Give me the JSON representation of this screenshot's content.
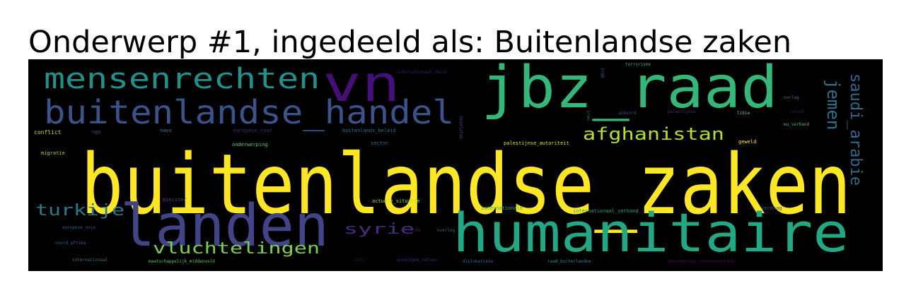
{
  "title": "Onderwerp #1, ingedeeld als: Buitenlandse zaken",
  "wordcloud": {
    "background": "#000000",
    "colormap": "viridis",
    "words": [
      {
        "text": "buitenlandse_zaken",
        "color": "#fde725"
      },
      {
        "text": "humanitaire",
        "color": "#22a884"
      },
      {
        "text": "landen",
        "color": "#414487"
      },
      {
        "text": "jbz_raad",
        "color": "#35b779"
      },
      {
        "text": "vn",
        "color": "#440f76"
      },
      {
        "text": "buitenlandse_handel",
        "color": "#3b528b"
      },
      {
        "text": "mensenrechten",
        "color": "#21918c"
      },
      {
        "text": "afghanistan",
        "color": "#b5de2b"
      },
      {
        "text": "vluchtelingen",
        "color": "#7ad151"
      },
      {
        "text": "turkije",
        "color": "#2a788e"
      },
      {
        "text": "syrie",
        "color": "#472d7b"
      },
      {
        "text": "jemen",
        "color": "#2c728e"
      },
      {
        "text": "saudi_arabie",
        "color": "#31688e"
      },
      {
        "text": "conflict",
        "color": "#bddf26"
      },
      {
        "text": "ngo",
        "color": "#3e4a89"
      },
      {
        "text": "navo",
        "color": "#26828e"
      },
      {
        "text": "europese_raad",
        "color": "#482173"
      },
      {
        "text": "buitenlands_beleid",
        "color": "#2e6e8e"
      },
      {
        "text": "internationaal_recht",
        "color": "#481a6c"
      },
      {
        "text": "terrorisme",
        "color": "#1fa187"
      },
      {
        "text": "israel",
        "color": "#471164"
      },
      {
        "text": "eu_verband",
        "color": "#3dbc74"
      },
      {
        "text": "libie",
        "color": "#6ece58"
      },
      {
        "text": "palestijnse",
        "color": "#482878"
      },
      {
        "text": "oorlog",
        "color": "#2d708e"
      },
      {
        "text": "akkoord",
        "color": "#3f4788"
      },
      {
        "text": "irak",
        "color": "#2f6b8e"
      },
      {
        "text": "iran",
        "color": "#287c8e"
      },
      {
        "text": "resolutie",
        "color": "#38598c"
      },
      {
        "text": "migratie",
        "color": "#9dd93b"
      },
      {
        "text": "onderwerping",
        "color": "#5ec962"
      },
      {
        "text": "sector",
        "color": "#306a8e"
      },
      {
        "text": "palestijnse_autoriteit",
        "color": "#d8e219"
      },
      {
        "text": "geweld",
        "color": "#fbe723"
      },
      {
        "text": "minister",
        "color": "#404588"
      },
      {
        "text": "actuele_situatie",
        "color": "#a5db36"
      },
      {
        "text": "internationale",
        "color": "#25ac82"
      },
      {
        "text": "internationaal_verband",
        "color": "#1e9b8a"
      },
      {
        "text": "verdrag",
        "color": "#3b518b"
      },
      {
        "text": "syrische",
        "color": "#481f70"
      },
      {
        "text": "europese_unie",
        "color": "#3a548c"
      },
      {
        "text": "noord_afrika",
        "color": "#34608d"
      },
      {
        "text": "internationaal",
        "color": "#2d718e"
      },
      {
        "text": "maatschappelijk_middenveld",
        "color": "#52c569"
      },
      {
        "text": "arab",
        "color": "#440154"
      },
      {
        "text": "verenigde_naties",
        "color": "#482475"
      },
      {
        "text": "diplomatieke",
        "color": "#365c8d"
      },
      {
        "text": "raad_buitenlandse",
        "color": "#24868e"
      },
      {
        "text": "bevordering_internationale",
        "color": "#46085c"
      },
      {
        "text": "overleg",
        "color": "#33628d"
      }
    ]
  }
}
